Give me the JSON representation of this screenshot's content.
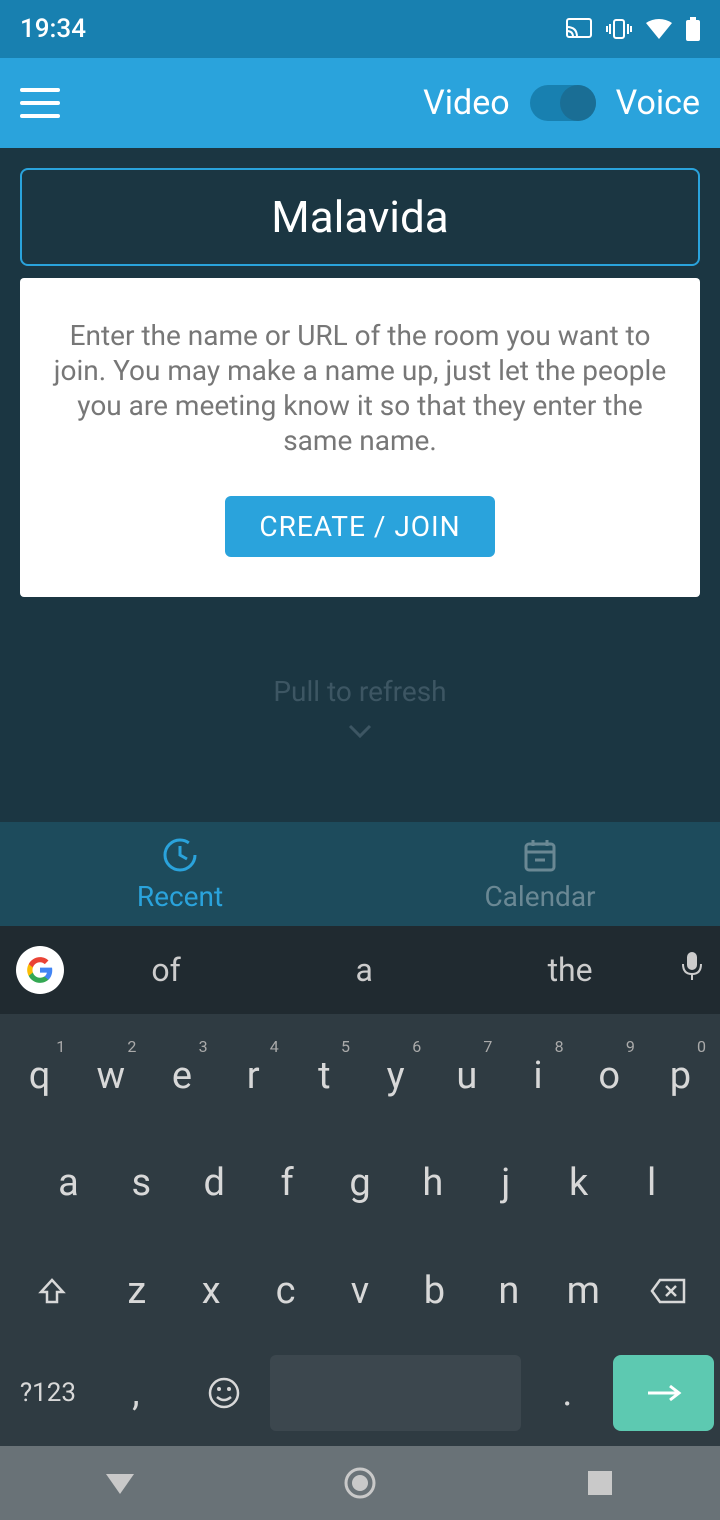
{
  "status": {
    "time": "19:34"
  },
  "appbar": {
    "video_label": "Video",
    "voice_label": "Voice"
  },
  "main": {
    "room_name": "Malavida",
    "help_text": "Enter the name or URL of the room you want to join. You may make a name up, just let the people you are meeting know it so that they enter the same name.",
    "create_button": "CREATE / JOIN",
    "pull_refresh": "Pull to refresh"
  },
  "tabs": {
    "recent": "Recent",
    "calendar": "Calendar"
  },
  "keyboard": {
    "suggestion1": "of",
    "suggestion2": "a",
    "suggestion3": "the",
    "row1": [
      {
        "k": "q",
        "s": "1"
      },
      {
        "k": "w",
        "s": "2"
      },
      {
        "k": "e",
        "s": "3"
      },
      {
        "k": "r",
        "s": "4"
      },
      {
        "k": "t",
        "s": "5"
      },
      {
        "k": "y",
        "s": "6"
      },
      {
        "k": "u",
        "s": "7"
      },
      {
        "k": "i",
        "s": "8"
      },
      {
        "k": "o",
        "s": "9"
      },
      {
        "k": "p",
        "s": "0"
      }
    ],
    "row2": [
      "a",
      "s",
      "d",
      "f",
      "g",
      "h",
      "j",
      "k",
      "l"
    ],
    "row3": [
      "z",
      "x",
      "c",
      "v",
      "b",
      "n",
      "m"
    ],
    "symbol_key": "?123",
    "comma": ",",
    "period": "."
  }
}
